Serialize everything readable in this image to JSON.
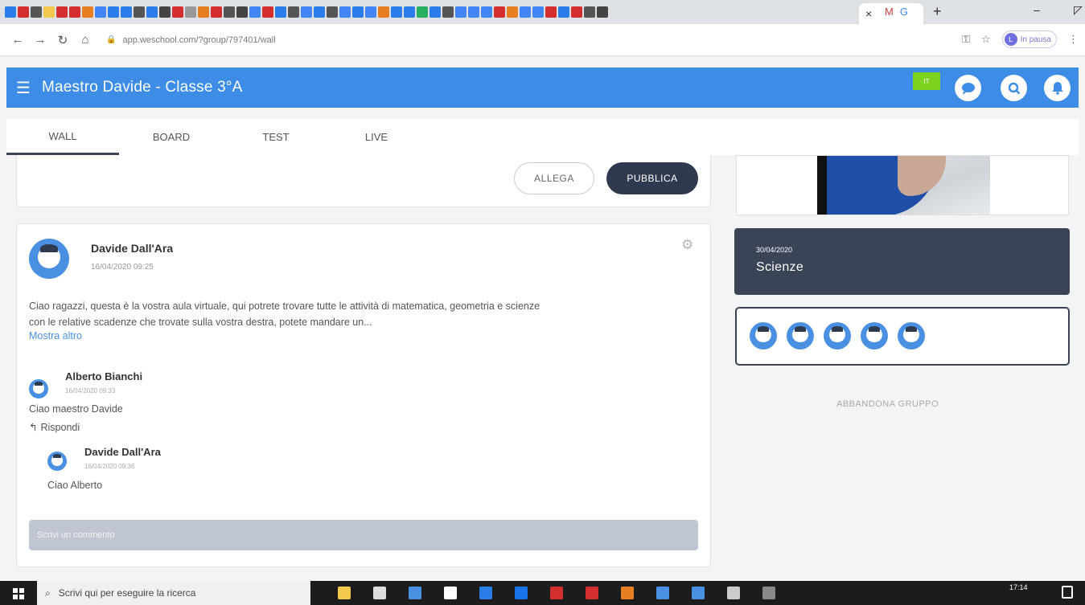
{
  "browser": {
    "active_tab_close": "×",
    "extra_tabs": [
      "M",
      "G"
    ],
    "new_tab": "+",
    "url": "app.weschool.com/?group/797401/wall",
    "profile_initial": "L",
    "profile_label": "In pausa",
    "favicon_colors": [
      "#2b7de9",
      "#d32f2f",
      "#555555",
      "#f2c94c",
      "#d32f2f",
      "#d32f2f",
      "#e67e22",
      "#4285f4",
      "#2b7de9",
      "#2b7de9",
      "#555555",
      "#2b7de9",
      "#444444",
      "#d32f2f",
      "#999999",
      "#e67e22",
      "#d32f2f",
      "#555555",
      "#444444",
      "#4285f4",
      "#d32f2f",
      "#2b7de9",
      "#555555",
      "#4285f4",
      "#2b7de9",
      "#555555",
      "#4285f4",
      "#2b7de9",
      "#4285f4",
      "#e67e22",
      "#2b7de9",
      "#2b7de9",
      "#27ae60",
      "#2b7de9",
      "#555555",
      "#4285f4",
      "#4285f4",
      "#4285f4",
      "#d32f2f",
      "#e67e22",
      "#4285f4",
      "#4285f4",
      "#d32f2f",
      "#2b7de9",
      "#d32f2f",
      "#555555",
      "#444444"
    ]
  },
  "app": {
    "title": "Maestro Davide - Classe 3°A",
    "flag_text": "IT",
    "accent_color": "#3d8de6",
    "dark_color": "#3b4456"
  },
  "tabs": [
    {
      "label": "WALL",
      "active": true
    },
    {
      "label": "BOARD",
      "active": false
    },
    {
      "label": "TEST",
      "active": false
    },
    {
      "label": "LIVE",
      "active": false
    }
  ],
  "composer": {
    "attach_label": "ALLEGA",
    "publish_label": "PUBBLICA"
  },
  "post": {
    "author": "Davide Dall'Ara",
    "timestamp": "16/04/2020 09:25",
    "body_line1": "Ciao ragazzi, questa è la vostra aula virtuale, qui potrete trovare tutte le attività di matematica, geometria e scienze",
    "body_line2": "con le relative scadenze che trovate sulla vostra destra, potete mandare un...",
    "show_more": "Mostra altro",
    "comments": [
      {
        "author": "Alberto Bianchi",
        "timestamp": "16/04/2020 09:33",
        "text": "Ciao maestro Davide"
      },
      {
        "author": "Davide Dall'Ara",
        "timestamp": "16/04/2020 09:36",
        "text": "Ciao Alberto"
      }
    ],
    "reply_label": "Rispondi",
    "comment_placeholder": "Scrivi un commento"
  },
  "sidebar": {
    "event": {
      "date": "30/04/2020",
      "title": "Scienze"
    },
    "member_count_shown": 5,
    "leave_group": "ABBANDONA GRUPPO"
  },
  "taskbar": {
    "search_placeholder": "Scrivi qui per eseguire la ricerca",
    "clock_time": "17:14",
    "icon_colors": [
      "#f2c94c",
      "#dddddd",
      "#4a90e2",
      "#ffffff",
      "#2b7de9",
      "#1a73e8",
      "#d32f2f",
      "#d32f2f",
      "#e67e22",
      "#4a90e2",
      "#4a90e2",
      "#cccccc",
      "#888888"
    ]
  }
}
